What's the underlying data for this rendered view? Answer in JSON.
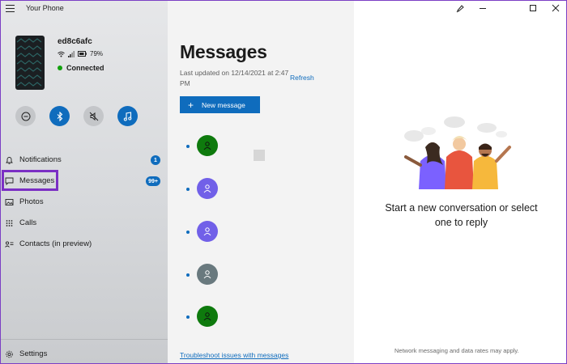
{
  "app": {
    "title": "Your Phone"
  },
  "device": {
    "name": "ed8c6afc",
    "battery": "79%",
    "status": "Connected"
  },
  "nav": [
    {
      "label": "Notifications",
      "badge": "1"
    },
    {
      "label": "Messages",
      "badge": "99+"
    },
    {
      "label": "Photos",
      "badge": ""
    },
    {
      "label": "Calls",
      "badge": ""
    },
    {
      "label": "Contacts (in preview)",
      "badge": ""
    }
  ],
  "settings": {
    "label": "Settings"
  },
  "messages": {
    "title": "Messages",
    "last_updated": "Last updated on 12/14/2021 at 2:47 PM",
    "refresh": "Refresh",
    "new_message": "New message",
    "troubleshoot": "Troubleshoot issues with messages",
    "conversations": [
      {
        "avatar_color": "#0e7a0d"
      },
      {
        "avatar_color": "#7160e8"
      },
      {
        "avatar_color": "#7160e8"
      },
      {
        "avatar_color": "#69797e"
      },
      {
        "avatar_color": "#0e7a0d"
      }
    ]
  },
  "empty_state": {
    "text": "Start a new conversation or select one to reply",
    "footer": "Network messaging and data rates may apply."
  },
  "colors": {
    "accent": "#0f6cbd",
    "connected": "#13a10e",
    "highlight": "#7b2fc4"
  }
}
